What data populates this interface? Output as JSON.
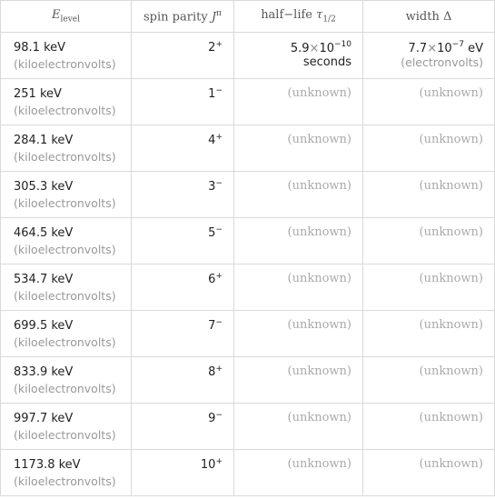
{
  "header": {
    "col1": {
      "symbol": "E",
      "sub": "level"
    },
    "col2": {
      "label": "spin parity ",
      "symbol": "J",
      "sup": "π"
    },
    "col3": {
      "label": "half−life ",
      "symbol": "τ",
      "sub": "1/2"
    },
    "col4": {
      "label": "width Δ"
    }
  },
  "rows": [
    {
      "level": "98.1 keV",
      "level_unit": "(kiloelectronvolts)",
      "spin": "2",
      "parity": "+",
      "half_life": {
        "mantissa": "5.9",
        "times": "×",
        "base": "10",
        "exp": "−10",
        "unit": "seconds"
      },
      "width": {
        "mantissa": "7.7",
        "times": "×",
        "base": "10",
        "exp": "−7",
        "unit": "eV",
        "unit_long": "(electronvolts)"
      }
    },
    {
      "level": "251 keV",
      "level_unit": "(kiloelectronvolts)",
      "spin": "1",
      "parity": "−",
      "half_life_text": "(unknown)",
      "width_text": "(unknown)"
    },
    {
      "level": "284.1 keV",
      "level_unit": "(kiloelectronvolts)",
      "spin": "4",
      "parity": "+",
      "half_life_text": "(unknown)",
      "width_text": "(unknown)"
    },
    {
      "level": "305.3 keV",
      "level_unit": "(kiloelectronvolts)",
      "spin": "3",
      "parity": "−",
      "half_life_text": "(unknown)",
      "width_text": "(unknown)"
    },
    {
      "level": "464.5 keV",
      "level_unit": "(kiloelectronvolts)",
      "spin": "5",
      "parity": "−",
      "half_life_text": "(unknown)",
      "width_text": "(unknown)"
    },
    {
      "level": "534.7 keV",
      "level_unit": "(kiloelectronvolts)",
      "spin": "6",
      "parity": "+",
      "half_life_text": "(unknown)",
      "width_text": "(unknown)"
    },
    {
      "level": "699.5 keV",
      "level_unit": "(kiloelectronvolts)",
      "spin": "7",
      "parity": "−",
      "half_life_text": "(unknown)",
      "width_text": "(unknown)"
    },
    {
      "level": "833.9 keV",
      "level_unit": "(kiloelectronvolts)",
      "spin": "8",
      "parity": "+",
      "half_life_text": "(unknown)",
      "width_text": "(unknown)"
    },
    {
      "level": "997.7 keV",
      "level_unit": "(kiloelectronvolts)",
      "spin": "9",
      "parity": "−",
      "half_life_text": "(unknown)",
      "width_text": "(unknown)"
    },
    {
      "level": "1173.8 keV",
      "level_unit": "(kiloelectronvolts)",
      "spin": "10",
      "parity": "+",
      "half_life_text": "(unknown)",
      "width_text": "(unknown)"
    }
  ]
}
